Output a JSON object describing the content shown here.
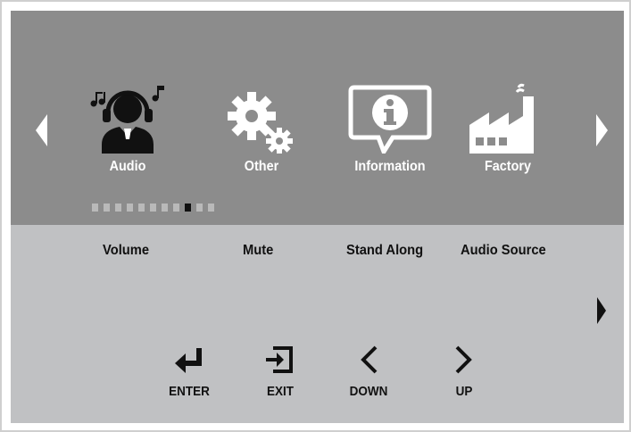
{
  "colors": {
    "top_panel": "#8c8c8c",
    "bottom_panel": "#c0c1c3",
    "icon": "#ffffff",
    "text_dark": "#111111",
    "dot_inactive": "#b9b9b9",
    "dot_active": "#111111"
  },
  "menu": {
    "items": [
      {
        "label": "Audio",
        "icon": "headphones-user-icon"
      },
      {
        "label": "Other",
        "icon": "gears-icon"
      },
      {
        "label": "Information",
        "icon": "info-bubble-icon"
      },
      {
        "label": "Factory",
        "icon": "factory-icon"
      }
    ],
    "page_indicator": {
      "total": 11,
      "current": 9
    }
  },
  "submenu": {
    "items": [
      "Volume",
      "Mute",
      "Stand Along",
      "Audio Source"
    ]
  },
  "keys": [
    {
      "label": "ENTER",
      "icon": "enter-icon"
    },
    {
      "label": "EXIT",
      "icon": "exit-icon"
    },
    {
      "label": "DOWN",
      "icon": "chevron-left-icon"
    },
    {
      "label": "UP",
      "icon": "chevron-right-icon"
    }
  ]
}
